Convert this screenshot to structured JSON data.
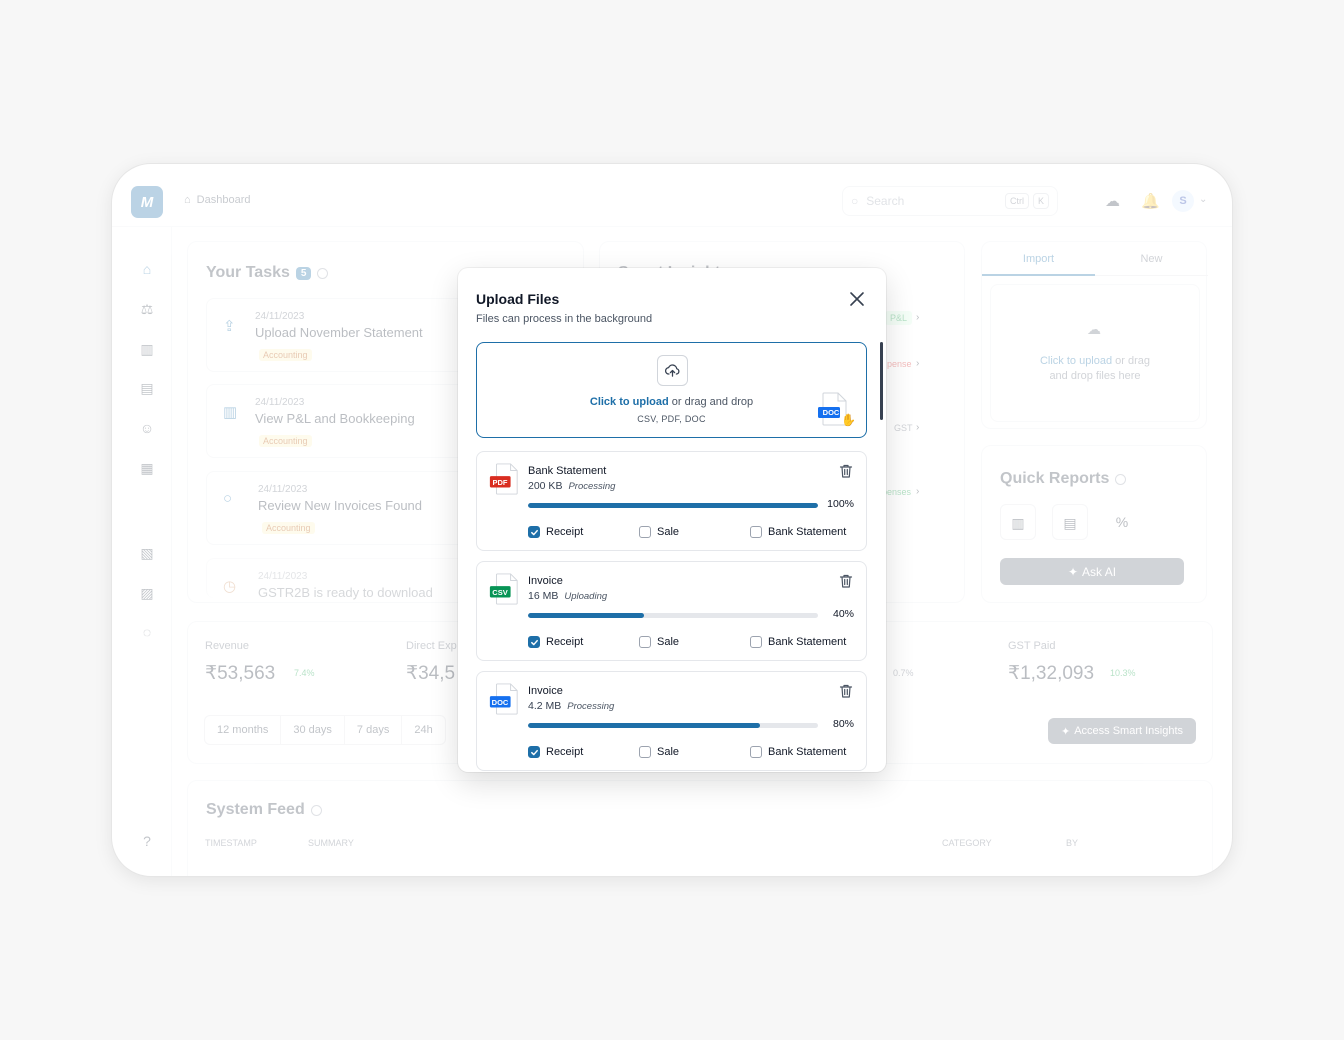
{
  "app": {
    "breadcrumb": "Dashboard",
    "search": {
      "placeholder": "Search",
      "kbd_1": "Ctrl",
      "kbd_2": "K"
    },
    "avatar_initial": "S"
  },
  "tasks": {
    "title": "Your Tasks",
    "count": "5",
    "items": [
      {
        "date": "24/11/2023",
        "title": "Upload November Statement",
        "tag": "Accounting"
      },
      {
        "date": "24/11/2023",
        "title": "View P&L and Bookkeeping",
        "tag": "Accounting"
      },
      {
        "date": "24/11/2023",
        "title": "Review New Invoices Found",
        "tag": "Accounting"
      },
      {
        "date": "24/11/2023",
        "title": "GSTR2B is ready to download"
      }
    ]
  },
  "insights": {
    "title": "Smart Insights",
    "tags": [
      "P&L",
      "pense",
      "GST",
      "penses"
    ]
  },
  "import_panel": {
    "tabs": [
      "Import",
      "New"
    ],
    "upload_link": "Click to upload",
    "upload_rest": " or drag",
    "upload_line2": "and drop files here"
  },
  "quick_reports": {
    "title": "Quick Reports",
    "ask_ai": "Ask AI"
  },
  "metrics": {
    "revenue_label": "Revenue",
    "revenue_value": "₹53,563",
    "revenue_delta": "7.4%",
    "direct_label": "Direct Exp",
    "direct_value": "₹34,5",
    "mid_delta": "0.7%",
    "gst_label": "GST Paid",
    "gst_value": "₹1,32,093",
    "gst_delta": "10.3%",
    "ranges": [
      "12 months",
      "30 days",
      "7 days",
      "24h"
    ],
    "access_button": "Access Smart Insights"
  },
  "feed": {
    "title": "System Feed",
    "columns": [
      "TIMESTAMP",
      "SUMMARY",
      "CATEGORY",
      "BY"
    ]
  },
  "modal": {
    "title": "Upload Files",
    "subtitle": "Files can process in the background",
    "dropzone": {
      "link": "Click to upload",
      "rest": " or drag and drop",
      "formats": "CSV, PDF, DOC",
      "drag_type": "DOC"
    },
    "files": [
      {
        "type": "PDF",
        "type_color": "#d92d20",
        "name": "Bank Statement",
        "size": "200 KB",
        "status": "Processing",
        "progress": 100,
        "progress_label": "100%",
        "options": [
          {
            "label": "Receipt",
            "checked": true
          },
          {
            "label": "Sale",
            "checked": false
          },
          {
            "label": "Bank Statement",
            "checked": false
          }
        ]
      },
      {
        "type": "CSV",
        "type_color": "#079455",
        "name": "Invoice",
        "size": "16 MB",
        "status": "Uploading",
        "progress": 40,
        "progress_label": "40%",
        "options": [
          {
            "label": "Receipt",
            "checked": true
          },
          {
            "label": "Sale",
            "checked": false
          },
          {
            "label": "Bank Statement",
            "checked": false
          }
        ]
      },
      {
        "type": "DOC",
        "type_color": "#1570ef",
        "name": "Invoice",
        "size": "4.2 MB",
        "status": "Processing",
        "progress": 80,
        "progress_label": "80%",
        "options": [
          {
            "label": "Receipt",
            "checked": true
          },
          {
            "label": "Sale",
            "checked": false
          },
          {
            "label": "Bank Statement",
            "checked": false
          }
        ]
      }
    ]
  },
  "colors": {
    "accent": "#1e6fa8",
    "pdf": "#d92d20",
    "csv": "#079455",
    "doc": "#1570ef"
  }
}
